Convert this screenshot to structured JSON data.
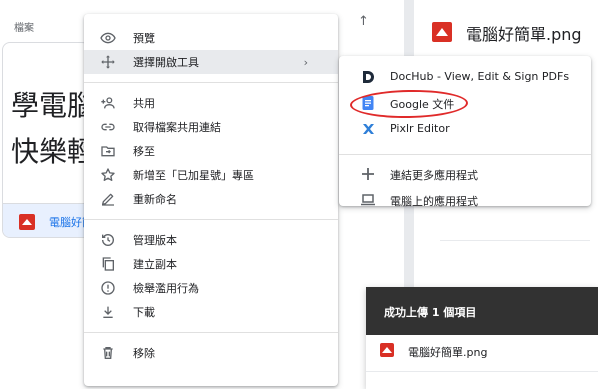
{
  "background": {
    "files_label": "檔案",
    "sort_arrow": "↑",
    "card": {
      "preview_text_line1": "學電腦",
      "preview_text_line2": "快樂輕",
      "file_name": "電腦好簡單.png"
    },
    "right_panel": {
      "title": "電腦好簡單.png"
    }
  },
  "context_menu": {
    "items": [
      {
        "label": "預覽",
        "icon": "eye-icon"
      },
      {
        "label": "選擇開啟工具",
        "icon": "move-icon",
        "has_submenu": true
      },
      {
        "label": "共用",
        "icon": "person-add-icon"
      },
      {
        "label": "取得檔案共用連結",
        "icon": "link-icon"
      },
      {
        "label": "移至",
        "icon": "move-to-folder-icon"
      },
      {
        "label": "新增至「已加星號」專區",
        "icon": "star-icon"
      },
      {
        "label": "重新命名",
        "icon": "pencil-icon"
      },
      {
        "label": "管理版本",
        "icon": "history-icon"
      },
      {
        "label": "建立副本",
        "icon": "copy-icon"
      },
      {
        "label": "檢舉濫用行為",
        "icon": "report-icon"
      },
      {
        "label": "下載",
        "icon": "download-icon"
      },
      {
        "label": "移除",
        "icon": "trash-icon"
      }
    ],
    "submenu_arrow": "›"
  },
  "open_with_submenu": {
    "apps": [
      {
        "label": "DocHub - View, Edit & Sign PDFs",
        "icon": "dochub-icon"
      },
      {
        "label": "Google 文件",
        "icon": "google-docs-icon"
      },
      {
        "label": "Pixlr Editor",
        "icon": "pixlr-icon"
      }
    ],
    "actions": [
      {
        "label": "連結更多應用程式",
        "icon": "plus-icon"
      },
      {
        "label": "電腦上的應用程式",
        "icon": "laptop-icon"
      }
    ]
  },
  "upload_toast": {
    "title": "成功上傳 1 個項目",
    "file_name": "電腦好簡單.png"
  },
  "colors": {
    "accent_blue": "#1a73e8",
    "image_file_red": "#d93025",
    "annotation_red": "#e02a2a",
    "toast_dark": "#323232"
  }
}
